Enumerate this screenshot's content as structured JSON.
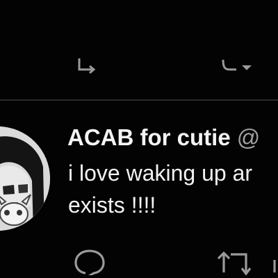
{
  "previous_tweet": {
    "actions": [
      {
        "icon": "retweet-icon"
      },
      {
        "icon": "like-icon"
      }
    ]
  },
  "tweet": {
    "author": {
      "display_name": "ACAB for cutie",
      "handle": "@",
      "avatar": "anime-character-avatar"
    },
    "text_lines": [
      "i love waking up ar",
      "exists !!!!"
    ],
    "actions": [
      {
        "icon": "reply-icon"
      },
      {
        "icon": "retweet-icon"
      },
      {
        "icon": "like-icon"
      }
    ]
  },
  "colors": {
    "background": "#030303",
    "primary_text": "#f4f4f4",
    "secondary_text": "#a0a0a0",
    "divider": "#2a2a2a",
    "icon": "#9a9a9a"
  }
}
